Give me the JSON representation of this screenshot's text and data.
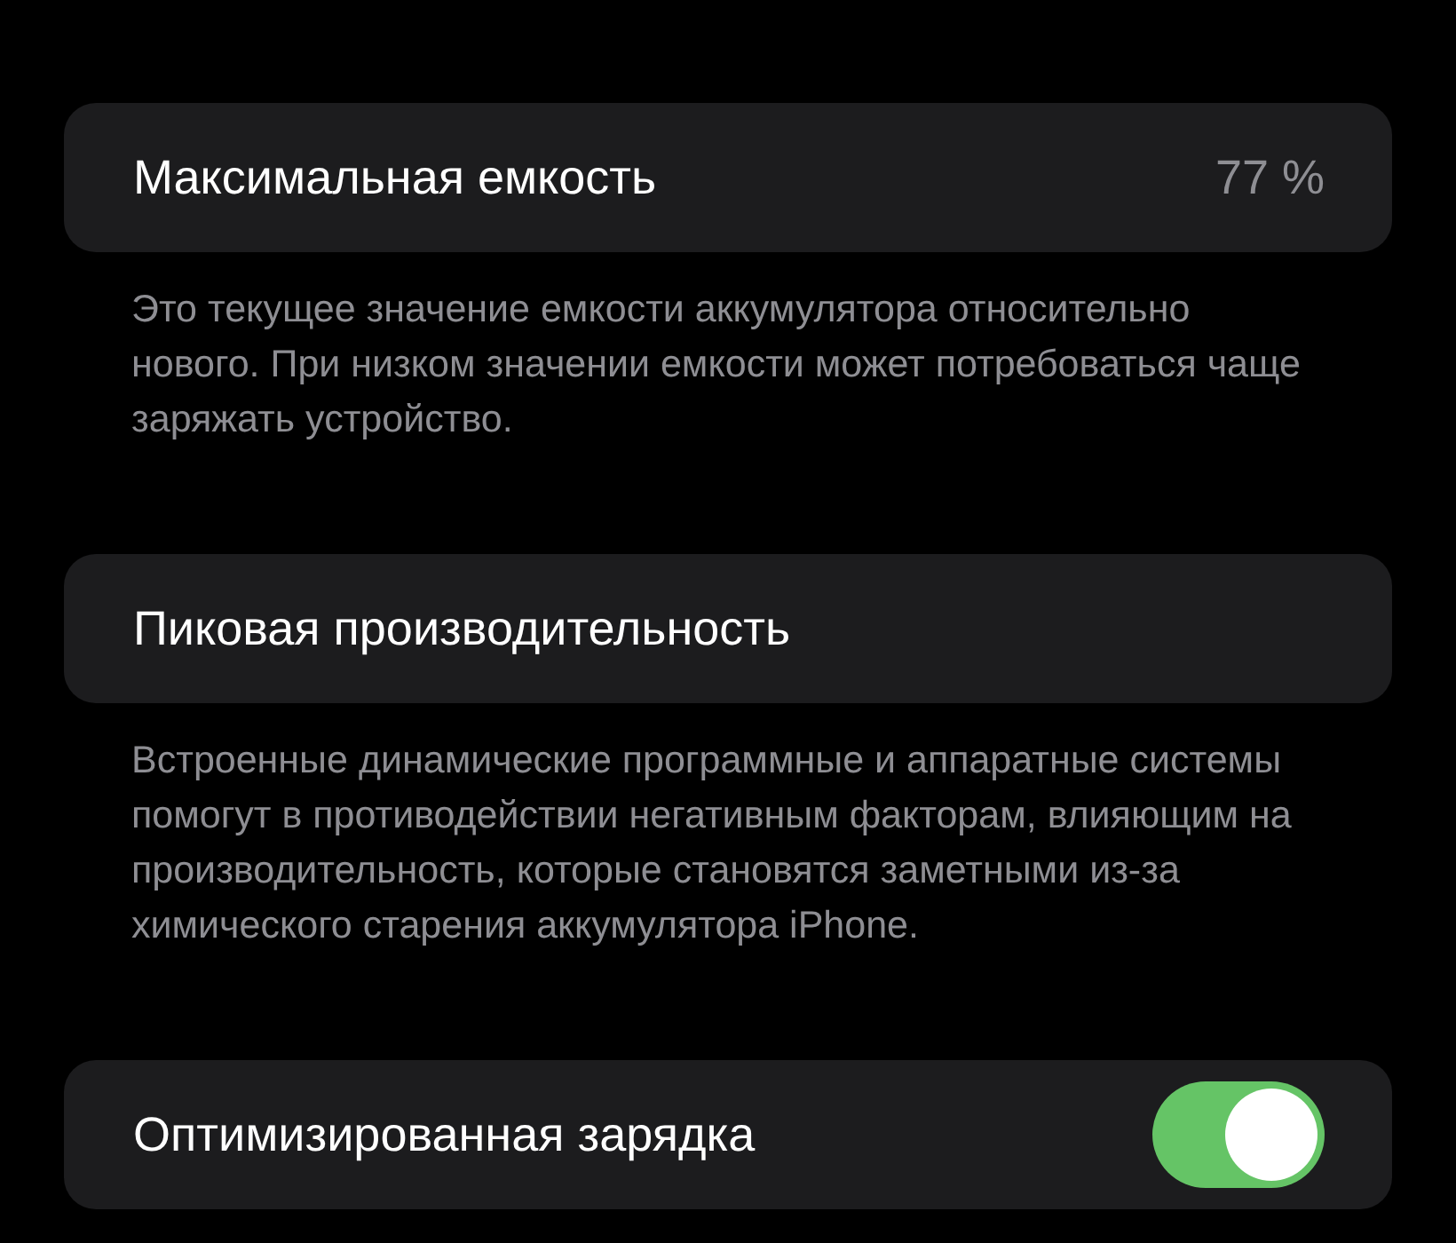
{
  "sections": [
    {
      "kind": "value",
      "label": "Максимальная емкость",
      "value": "77 %",
      "description": "Это текущее значение емкости аккумулятора относительно нового. При низком значении емкости может потребоваться чаще заряжать устройство."
    },
    {
      "kind": "plain",
      "label": "Пиковая производительность",
      "description": "Встроенные динамические программные и аппаратные системы помогут в противодействии негативным факторам, влияющим на производительность, которые становятся заметными из-за химического старения аккумулятора iPhone."
    },
    {
      "kind": "toggle",
      "label": "Оптимизированная зарядка",
      "on": true
    }
  ]
}
